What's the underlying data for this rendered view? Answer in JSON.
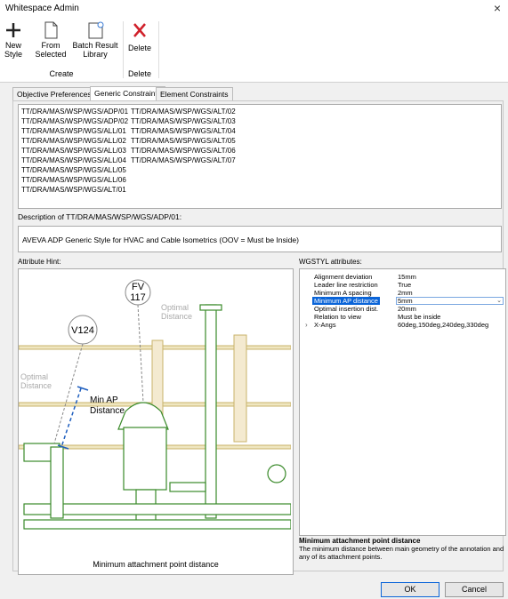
{
  "window": {
    "title": "Whitespace Admin",
    "close": "×"
  },
  "ribbon": {
    "new_style": "New\nStyle",
    "from_selected": "From\nSelected",
    "batch_library": "Batch Result\nLibrary",
    "delete": "Delete",
    "group_create": "Create",
    "group_delete": "Delete"
  },
  "tabs": [
    "Objective Preferences",
    "Generic Constraints",
    "Element Constraints"
  ],
  "styles_col1": [
    "TT/DRA/MAS/WSP/WGS/ADP/01",
    "TT/DRA/MAS/WSP/WGS/ADP/02",
    "TT/DRA/MAS/WSP/WGS/ALL/01",
    "TT/DRA/MAS/WSP/WGS/ALL/02",
    "TT/DRA/MAS/WSP/WGS/ALL/03",
    "TT/DRA/MAS/WSP/WGS/ALL/04",
    "TT/DRA/MAS/WSP/WGS/ALL/05",
    "TT/DRA/MAS/WSP/WGS/ALL/06",
    "TT/DRA/MAS/WSP/WGS/ALT/01"
  ],
  "styles_col2": [
    "TT/DRA/MAS/WSP/WGS/ALT/02",
    "TT/DRA/MAS/WSP/WGS/ALT/03",
    "TT/DRA/MAS/WSP/WGS/ALT/04",
    "TT/DRA/MAS/WSP/WGS/ALT/05",
    "TT/DRA/MAS/WSP/WGS/ALT/06",
    "TT/DRA/MAS/WSP/WGS/ALT/07"
  ],
  "description": {
    "label": "Description of TT/DRA/MAS/WSP/WGS/ADP/01:",
    "text": "AVEVA ADP Generic Style for HVAC and Cable Isometrics (OOV = Must be Inside)"
  },
  "hint": {
    "label": "Attribute Hint:",
    "caption": "Minimum attachment point distance",
    "diagram": {
      "tag1": "FV",
      "tag1b": "117",
      "tag2": "V124",
      "optimal1": "Optimal",
      "optimal1b": "Distance",
      "optimal2": "Optimal",
      "optimal2b": "Distance",
      "minap": "Min AP",
      "minapb": "Distance"
    }
  },
  "attributes": {
    "label": "WGSTYL attributes:",
    "rows": [
      {
        "name": "Alignment deviation",
        "value": "15mm"
      },
      {
        "name": "Leader line restriction",
        "value": "True"
      },
      {
        "name": "Minimum A spacing",
        "value": "2mm"
      },
      {
        "name": "Minimum AP distance",
        "value": "5mm"
      },
      {
        "name": "Optimal insertion dist.",
        "value": "20mm"
      },
      {
        "name": "Relation to view",
        "value": "Must be inside"
      },
      {
        "name": "X-Angs",
        "value": "60deg,150deg,240deg,330deg"
      }
    ]
  },
  "help": {
    "title": "Minimum attachment point distance",
    "text": "The minimum distance between main geometry of the annotation and any of its attachment points."
  },
  "buttons": {
    "ok": "OK",
    "cancel": "Cancel"
  }
}
